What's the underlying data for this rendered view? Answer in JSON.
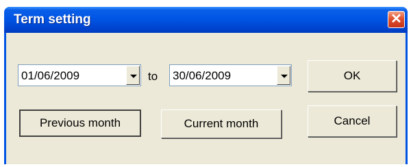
{
  "window": {
    "title": "Term setting",
    "close_glyph": "✕"
  },
  "term": {
    "from": "01/06/2009",
    "separator": "to",
    "to": "30/06/2009"
  },
  "buttons": {
    "ok": "OK",
    "cancel": "Cancel",
    "previous_month": "Previous month",
    "current_month": "Current month"
  }
}
